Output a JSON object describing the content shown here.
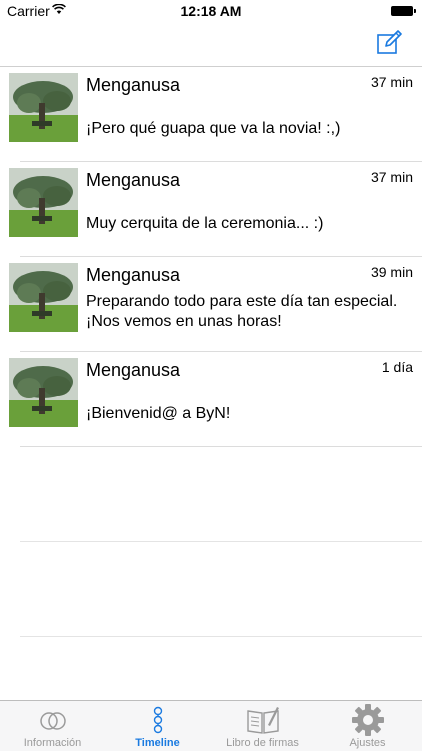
{
  "status": {
    "carrier": "Carrier",
    "time": "12:18 AM"
  },
  "nav": {
    "compose_icon": "compose-icon"
  },
  "feed": [
    {
      "author": "Menganusa",
      "time": "37 min",
      "message": "¡Pero qué guapa que va la novia! :,)"
    },
    {
      "author": "Menganusa",
      "time": "37 min",
      "message": "Muy cerquita de la ceremonia... :)"
    },
    {
      "author": "Menganusa",
      "time": "39 min",
      "message": "Preparando todo para este día tan especial. ¡Nos vemos en unas horas!"
    },
    {
      "author": "Menganusa",
      "time": "1 día",
      "message": "¡Bienvenid@ a ByN!"
    }
  ],
  "tabs": [
    {
      "label": "Información",
      "icon": "rings-icon",
      "active": false
    },
    {
      "label": "Timeline",
      "icon": "timeline-icon",
      "active": true
    },
    {
      "label": "Libro de firmas",
      "icon": "book-icon",
      "active": false
    },
    {
      "label": "Ajustes",
      "icon": "gear-icon",
      "active": false
    }
  ],
  "colors": {
    "accent": "#1a7ae0",
    "tab_inactive": "#9a9a9a"
  }
}
